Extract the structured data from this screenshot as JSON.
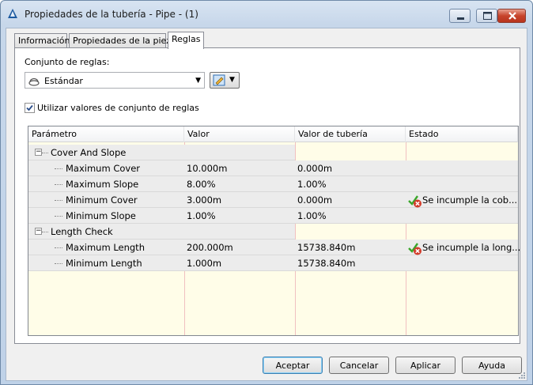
{
  "window": {
    "title": "Propiedades de la tubería - Pipe - (1)"
  },
  "tabs": [
    {
      "label": "Información"
    },
    {
      "label": "Propiedades de la pieza"
    },
    {
      "label": "Reglas",
      "selected": true
    }
  ],
  "rules": {
    "ruleset_label": "Conjunto de reglas:",
    "ruleset_value": "Estándar",
    "use_ruleset_values_label": "Utilizar valores de conjunto de reglas",
    "use_ruleset_values_checked": true
  },
  "grid": {
    "columns": [
      "Parámetro",
      "Valor",
      "Valor de tubería",
      "Estado"
    ],
    "groups": [
      {
        "name": "Cover And Slope",
        "rows": [
          {
            "param": "Maximum Cover",
            "value": "10.000m",
            "pipe_value": "0.000m",
            "status": ""
          },
          {
            "param": "Maximum Slope",
            "value": "8.00%",
            "pipe_value": "1.00%",
            "status": ""
          },
          {
            "param": "Minimum Cover",
            "value": "3.000m",
            "pipe_value": "0.000m",
            "status": "Se incumple la cob..."
          },
          {
            "param": "Minimum Slope",
            "value": "1.00%",
            "pipe_value": "1.00%",
            "status": ""
          }
        ]
      },
      {
        "name": "Length Check",
        "rows": [
          {
            "param": "Maximum Length",
            "value": "200.000m",
            "pipe_value": "15738.840m",
            "status": "Se incumple la long..."
          },
          {
            "param": "Minimum Length",
            "value": "1.000m",
            "pipe_value": "15738.840m",
            "status": ""
          }
        ]
      }
    ]
  },
  "buttons": {
    "ok": "Aceptar",
    "cancel": "Cancelar",
    "apply": "Aplicar",
    "help": "Ayuda"
  },
  "icons": {
    "app": "civil3d-app-icon",
    "ruleset": "ruleset-icon",
    "edit": "edit-ruleset-icon",
    "violation": "rule-violation-icon"
  },
  "colors": {
    "grid_background": "#fffde8",
    "row_background": "#ececec",
    "column_divider": "#f1c0c0",
    "violation_check": "#3aa62b",
    "violation_x": "#d23b2a"
  }
}
